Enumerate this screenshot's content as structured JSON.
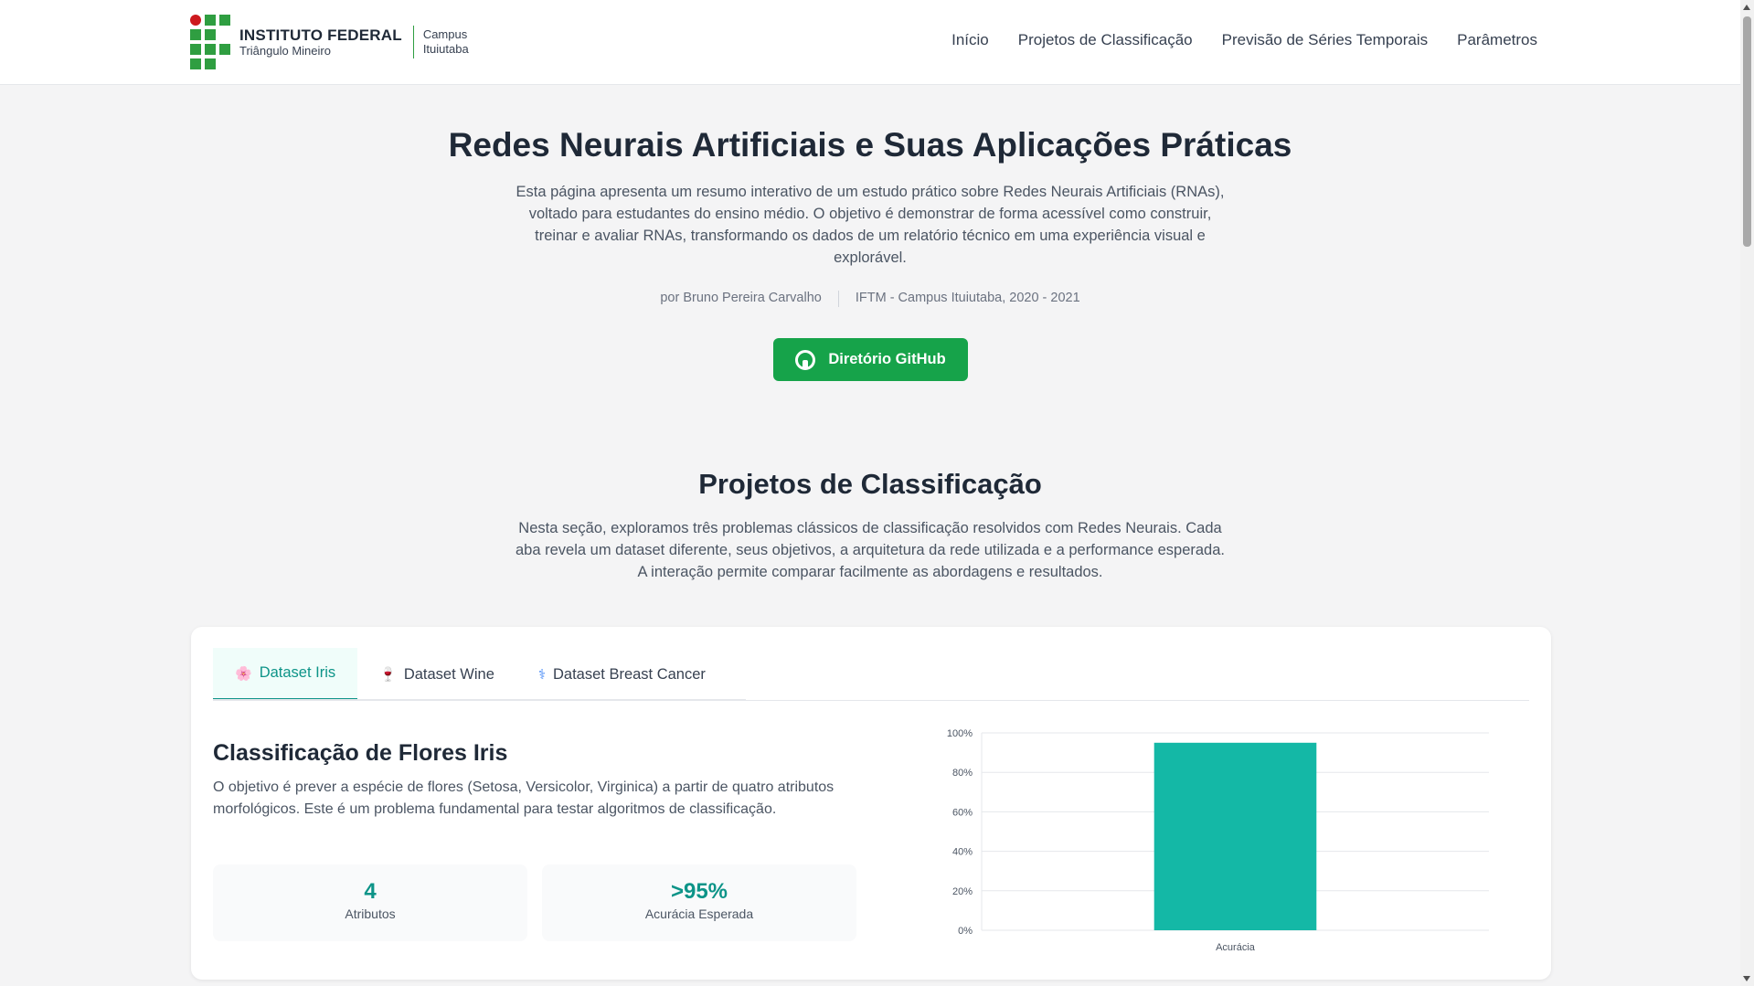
{
  "header": {
    "logo_name": "INSTITUTO FEDERAL",
    "logo_sub": "Triângulo Mineiro",
    "campus_line1": "Campus",
    "campus_line2": "Ituiutaba",
    "nav": [
      "Início",
      "Projetos de Classificação",
      "Previsão de Séries Temporais",
      "Parâmetros"
    ]
  },
  "hero": {
    "title": "Redes Neurais Artificiais e Suas Aplicações Práticas",
    "description": "Esta página apresenta um resumo interativo de um estudo prático sobre Redes Neurais Artificiais (RNAs), voltado para estudantes do ensino médio. O objetivo é demonstrar de forma acessível como construir, treinar e avaliar RNAs, transformando os dados de um relatório técnico em uma experiência visual e explorável.",
    "author": "por Bruno Pereira Carvalho",
    "institution": "IFTM - Campus Ituiutaba, 2020 - 2021",
    "github_label": "Diretório GitHub"
  },
  "section": {
    "title": "Projetos de Classificação",
    "description": "Nesta seção, exploramos três problemas clássicos de classificação resolvidos com Redes Neurais. Cada aba revela um dataset diferente, seus objetivos, a arquitetura da rede utilizada e a performance esperada. A interação permite comparar facilmente as abordagens e resultados."
  },
  "tabs": [
    {
      "label": "Dataset Iris",
      "icon": "🌸"
    },
    {
      "label": "Dataset Wine",
      "icon": "🍷"
    },
    {
      "label": "Dataset Breast Cancer",
      "icon": "⚕"
    }
  ],
  "panel": {
    "title": "Classificação de Flores Iris",
    "description": "O objetivo é prever a espécie de flores (Setosa, Versicolor, Virginica) a partir de quatro atributos morfológicos. Este é um problema fundamental para testar algoritmos de classificação.",
    "stats": [
      {
        "value": "4",
        "label": "Atributos"
      },
      {
        "value": ">95%",
        "label": "Acurácia Esperada"
      }
    ]
  },
  "colors": {
    "accent": "#0d9488",
    "bar": "#14b8a6",
    "github_button": "#16a34a"
  },
  "chart_data": {
    "type": "bar",
    "categories": [
      "Acurácia"
    ],
    "values": [
      95
    ],
    "ylim": [
      0,
      100
    ],
    "yticks": [
      "0%",
      "20%",
      "40%",
      "60%",
      "80%",
      "100%"
    ],
    "grid": true
  }
}
